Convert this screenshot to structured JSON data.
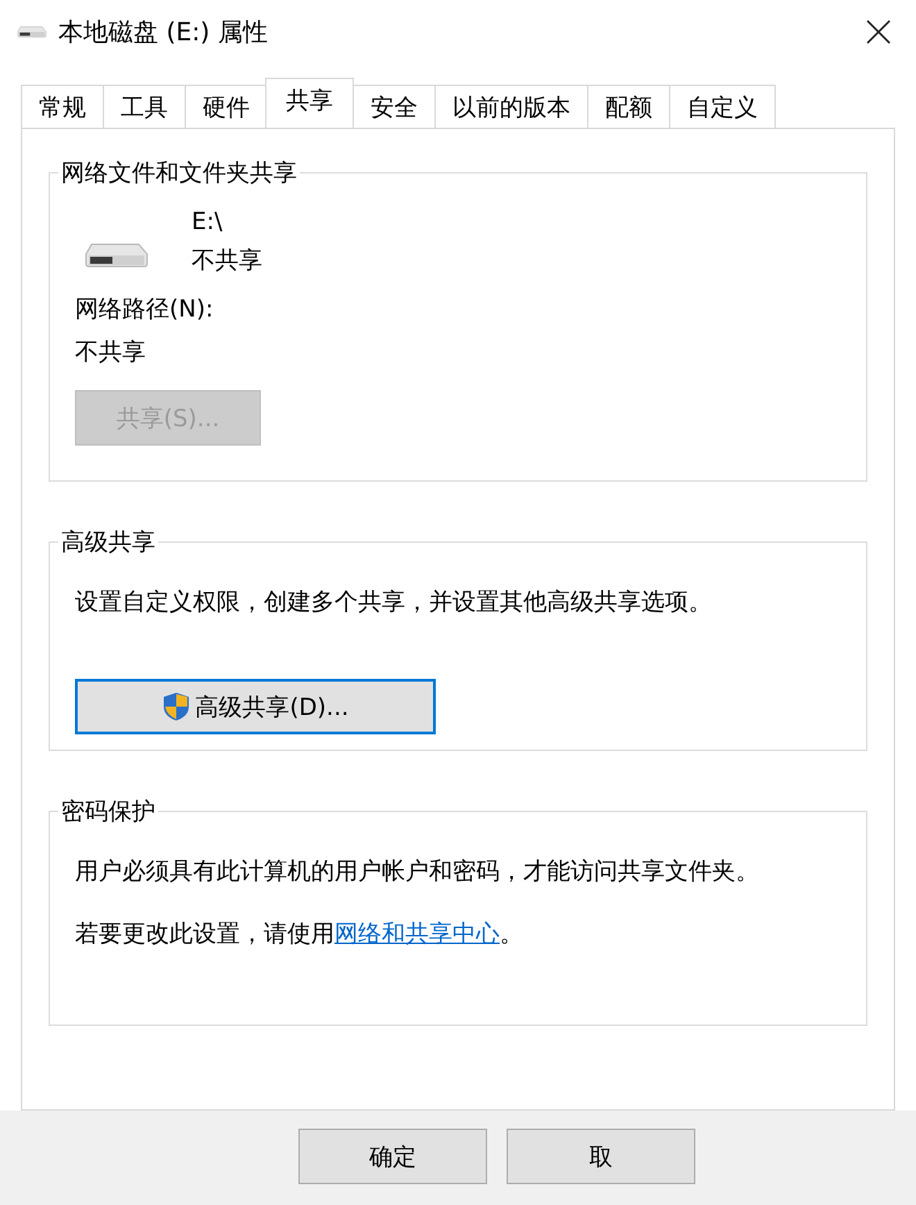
{
  "window": {
    "title": "本地磁盘 (E:) 属性"
  },
  "tabs": [
    {
      "label": "常规",
      "selected": false
    },
    {
      "label": "工具",
      "selected": false
    },
    {
      "label": "硬件",
      "selected": false
    },
    {
      "label": "共享",
      "selected": true
    },
    {
      "label": "安全",
      "selected": false
    },
    {
      "label": "以前的版本",
      "selected": false
    },
    {
      "label": "配额",
      "selected": false
    },
    {
      "label": "自定义",
      "selected": false
    }
  ],
  "sharing_group": {
    "title": "网络文件和文件夹共享",
    "drive": "E:\\",
    "status": "不共享",
    "path_label": "网络路径(N):",
    "path_value": "不共享",
    "share_button": {
      "label": "共享(S)...",
      "disabled": true
    }
  },
  "advanced_group": {
    "title": "高级共享",
    "description": "设置自定义权限，创建多个共享，并设置其他高级共享选项。",
    "button": {
      "label": "高级共享(D)...",
      "focused": true
    }
  },
  "password_group": {
    "title": "密码保护",
    "description": "用户必须具有此计算机的用户帐户和密码，才能访问共享文件夹。",
    "note": "若要更改此设置，请使用",
    "link": "网络和共享中心",
    "note_end": "。"
  },
  "buttons": [
    {
      "label": "确定"
    },
    {
      "label": "取"
    }
  ]
}
